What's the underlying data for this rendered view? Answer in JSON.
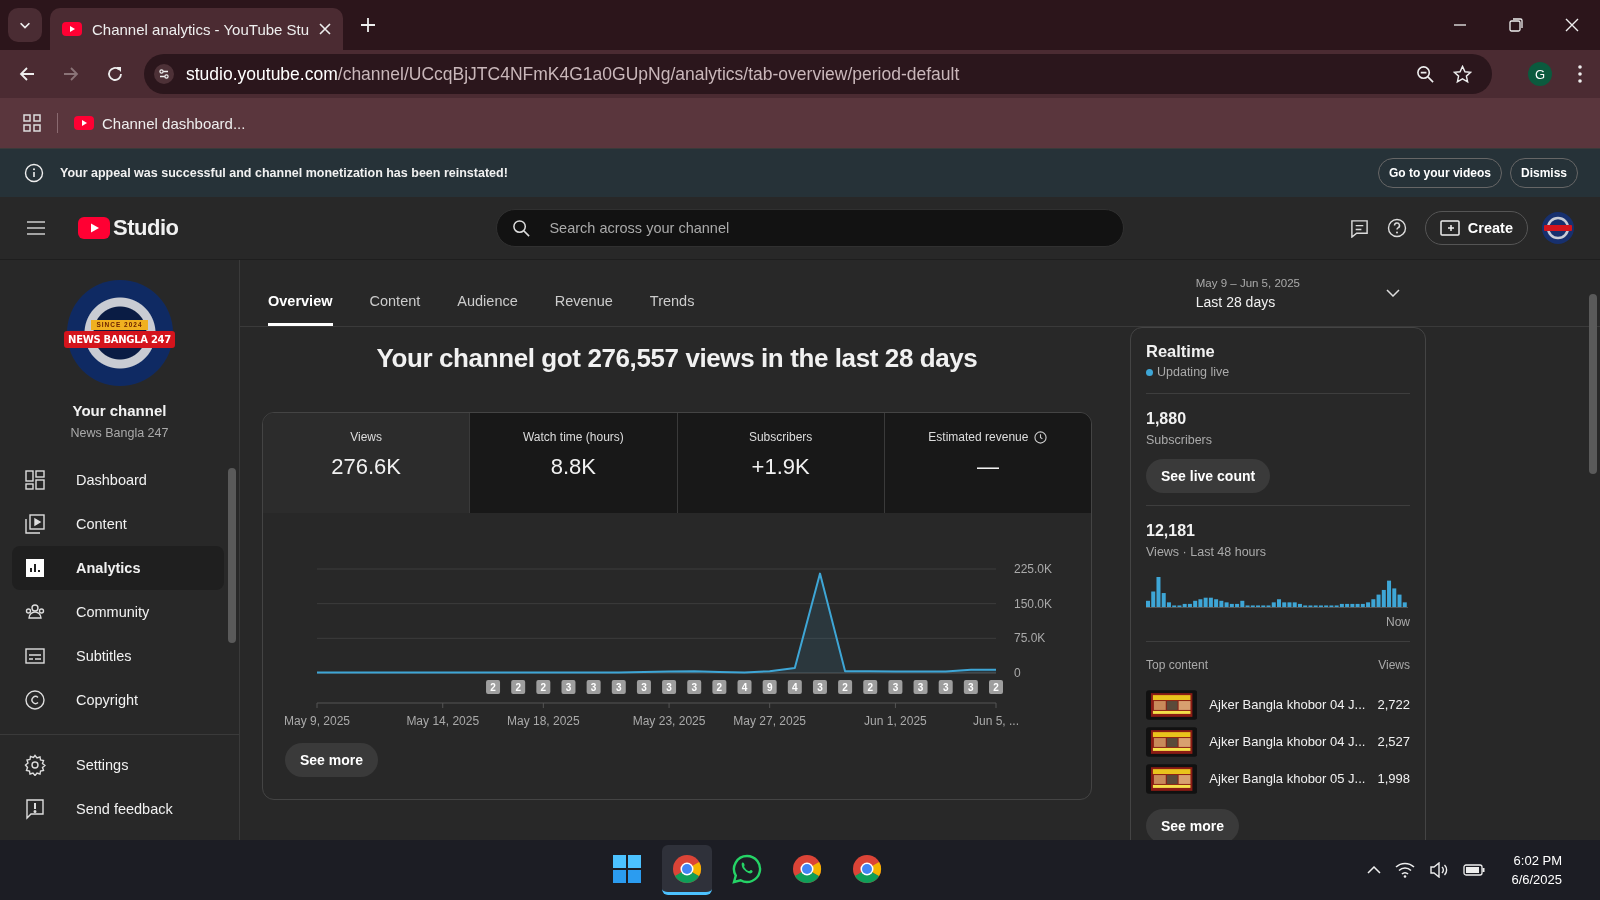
{
  "browser": {
    "tabs": [
      {
        "title": "Channel analytics - YouTube Stu",
        "selected": true
      }
    ],
    "url_host": "studio.youtube.com",
    "url_path": "/channel/UCcqBjJTC4NFmK4G1a0GUpNg/analytics/tab-overview/period-default",
    "profile_initial": "G",
    "bookmarks": [
      {
        "label": "Channel dashboard..."
      }
    ]
  },
  "banner": {
    "message": "Your appeal was successful and channel monetization has been reinstated!",
    "buttons": [
      "Go to your videos",
      "Dismiss"
    ]
  },
  "header": {
    "logo_text": "Studio",
    "search_placeholder": "Search across your channel",
    "create_label": "Create"
  },
  "sidebar": {
    "avatar": {
      "tagline": "SINCE 2024",
      "banner": "NEWS BANGLA 247"
    },
    "channel_title": "Your channel",
    "channel_name": "News Bangla 247",
    "items": [
      {
        "label": "Dashboard",
        "selected": false
      },
      {
        "label": "Content",
        "selected": false
      },
      {
        "label": "Analytics",
        "selected": true
      },
      {
        "label": "Community",
        "selected": false
      },
      {
        "label": "Subtitles",
        "selected": false
      },
      {
        "label": "Copyright",
        "selected": false
      }
    ],
    "footer_items": [
      {
        "label": "Settings"
      },
      {
        "label": "Send feedback"
      }
    ]
  },
  "analytics": {
    "tabs": [
      {
        "label": "Overview",
        "selected": true
      },
      {
        "label": "Content",
        "selected": false
      },
      {
        "label": "Audience",
        "selected": false
      },
      {
        "label": "Revenue",
        "selected": false
      },
      {
        "label": "Trends",
        "selected": false
      }
    ],
    "date_range": {
      "dates": "May 9 – Jun 5, 2025",
      "label": "Last 28 days"
    },
    "headline": "Your channel got 276,557 views in the last 28 days",
    "metrics": [
      {
        "label": "Views",
        "value": "276.6K",
        "selected": true,
        "info_icon": false
      },
      {
        "label": "Watch time (hours)",
        "value": "8.8K",
        "selected": false,
        "info_icon": false
      },
      {
        "label": "Subscribers",
        "value": "+1.9K",
        "selected": false,
        "info_icon": false
      },
      {
        "label": "Estimated revenue",
        "value": "—",
        "selected": false,
        "info_icon": true
      }
    ],
    "chart_data": {
      "type": "line",
      "categories": [
        "May 9, 2025",
        null,
        null,
        null,
        null,
        "May 14, 2025",
        null,
        null,
        null,
        "May 18, 2025",
        null,
        null,
        null,
        null,
        "May 23, 2025",
        null,
        null,
        null,
        "May 27, 2025",
        null,
        null,
        null,
        null,
        "Jun 1, 2025",
        null,
        null,
        null,
        "Jun 5, ..."
      ],
      "series": [
        {
          "color": "#3ea6d6",
          "values": [
            1000,
            1000,
            1000,
            1000,
            1000,
            1000,
            1000,
            1000,
            1000,
            1000,
            1000,
            1000,
            1000,
            2000,
            3000,
            4000,
            2000,
            1000,
            4000,
            11000,
            215000,
            4000,
            4000,
            3000,
            3000,
            3000,
            7000,
            7000
          ]
        }
      ],
      "ylim": [
        0,
        225000
      ],
      "yticks": [
        {
          "value": 0,
          "label": "0"
        },
        {
          "value": 75000,
          "label": "75.0K"
        },
        {
          "value": 150000,
          "label": "150.0K"
        },
        {
          "value": 225000,
          "label": "225.0K"
        }
      ]
    },
    "video_markers": [
      {
        "count": "2"
      },
      {
        "count": "2"
      },
      {
        "count": "2"
      },
      {
        "count": "3"
      },
      {
        "count": "3"
      },
      {
        "count": "3"
      },
      {
        "count": "3"
      },
      {
        "count": "3"
      },
      {
        "count": "3"
      },
      {
        "count": "2"
      },
      {
        "count": "4"
      },
      {
        "count": "9"
      },
      {
        "count": "4"
      },
      {
        "count": "3"
      },
      {
        "count": "2"
      },
      {
        "count": "2"
      },
      {
        "count": "3"
      },
      {
        "count": "3"
      },
      {
        "count": "3"
      },
      {
        "count": "3"
      },
      {
        "count": "2"
      }
    ],
    "see_more": "See more"
  },
  "realtime": {
    "title": "Realtime",
    "status": "Updating live",
    "subscribers": {
      "value": "1,880",
      "label": "Subscribers"
    },
    "live_button": "See live count",
    "views": {
      "value": "12,181",
      "label": "Views · Last 48 hours"
    },
    "now_label": "Now",
    "top_header": "Top content",
    "views_header": "Views",
    "items": [
      {
        "title": "Ajker Bangla khobor 04 J...",
        "views": "2,722"
      },
      {
        "title": "Ajker Bangla khobor 04 J...",
        "views": "2,527"
      },
      {
        "title": "Ajker Bangla khobor 05 J...",
        "views": "1,998"
      }
    ],
    "see_more": "See more"
  },
  "taskbar": {
    "apps": [
      {
        "kind": "start",
        "active": false
      },
      {
        "kind": "chrome",
        "active": true
      },
      {
        "kind": "whatsapp",
        "active": false
      },
      {
        "kind": "chrome",
        "active": false
      },
      {
        "kind": "chrome",
        "active": false
      }
    ],
    "time": "6:02 PM",
    "date": "6/6/2025"
  }
}
